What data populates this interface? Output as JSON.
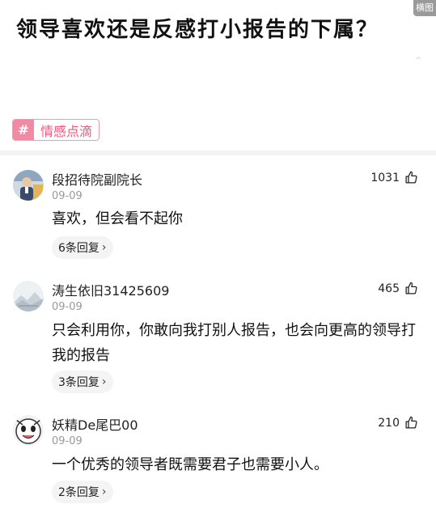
{
  "corner_badge": "横图",
  "question": {
    "title": "领导喜欢还是反感打小报告的下属？"
  },
  "topic": {
    "icon": "hash-icon",
    "label": "情感点滴"
  },
  "comments": [
    {
      "username": "段招待院副院长",
      "date": "09-09",
      "likes": "1031",
      "content": "喜欢，但会看不起你",
      "replies": "6条回复"
    },
    {
      "username": "涛生依旧31425609",
      "date": "09-09",
      "likes": "465",
      "content": "只会利用你，你敢向我打别人报告，也会向更高的领导打我的报告",
      "replies": "3条回复"
    },
    {
      "username": "妖精De尾巴00",
      "date": "09-09",
      "likes": "210",
      "content": "一个优秀的领导者既需要君子也需要小人。",
      "replies": "2条回复"
    }
  ],
  "colors": {
    "tag_pink": "#ee5a7c",
    "tag_fill": "#f38aa3",
    "muted": "#999999"
  }
}
